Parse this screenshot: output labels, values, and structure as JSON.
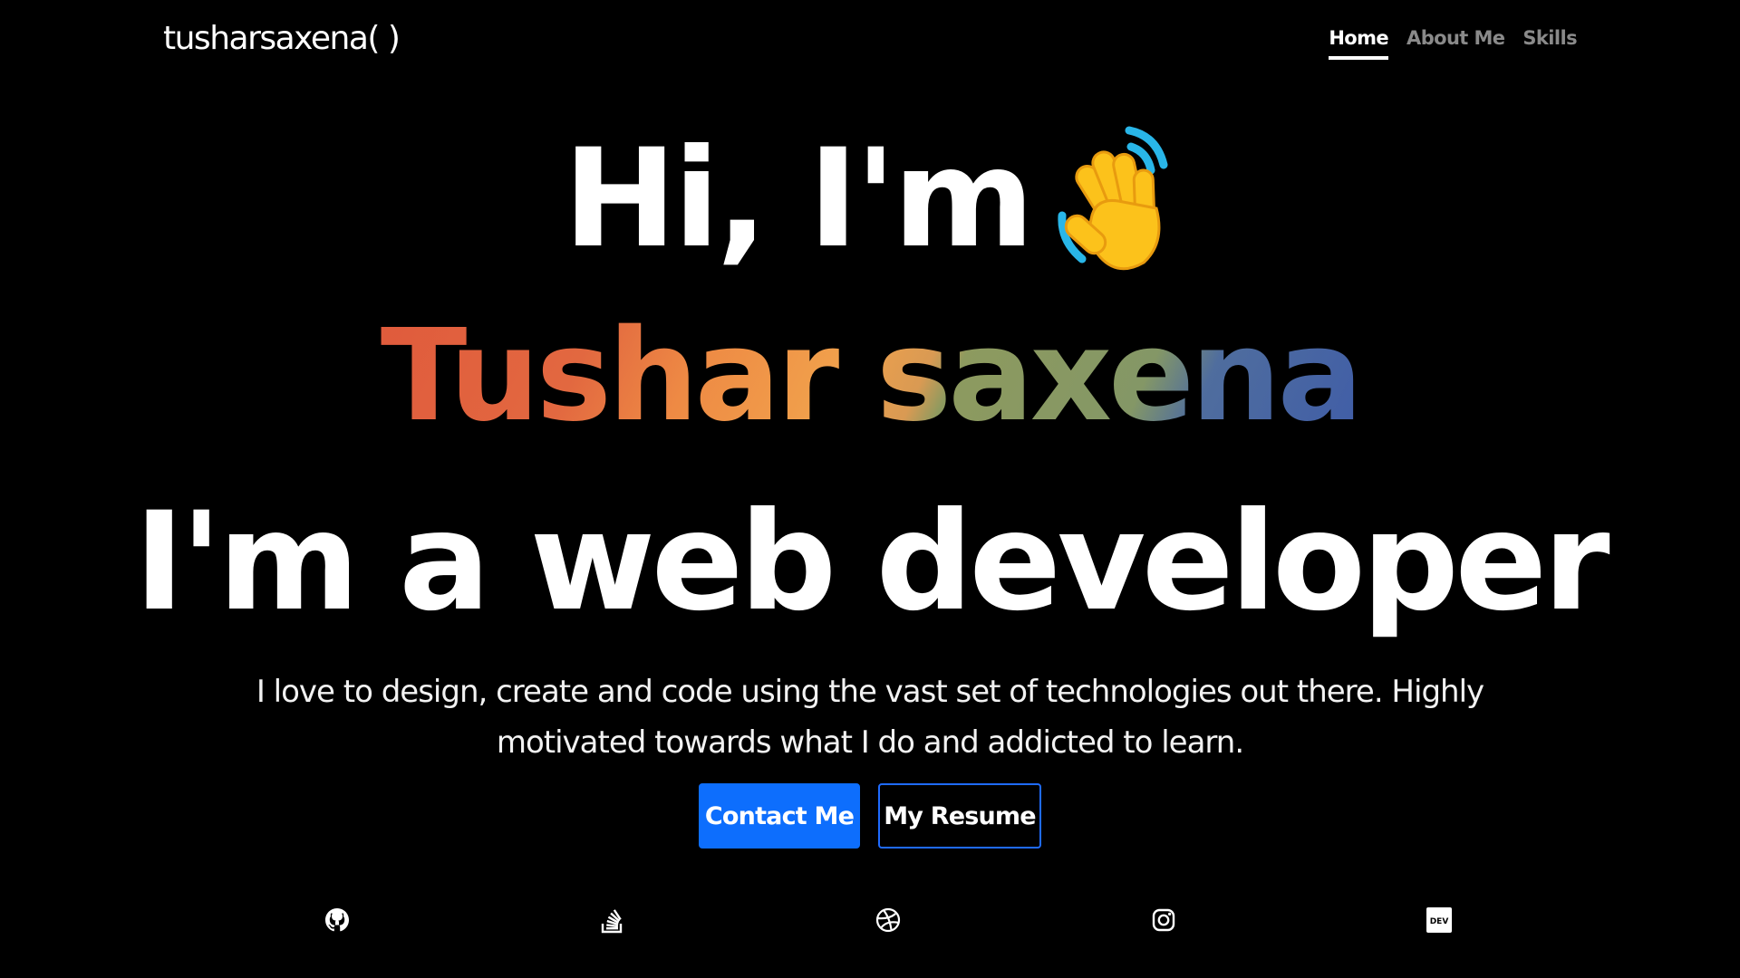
{
  "header": {
    "brand": "tusharsaxena( )",
    "nav": [
      {
        "label": "Home",
        "active": true
      },
      {
        "label": "About Me",
        "active": false
      },
      {
        "label": "Skills",
        "active": false
      }
    ]
  },
  "hero": {
    "greeting": "Hi, I'm",
    "greeting_icon": "waving-hand-icon",
    "name": "Tushar saxena",
    "role": "I'm a web developer",
    "intro": "I love to design, create and code using the vast set of technologies out there. Highly motivated towards what I do and addicted to learn."
  },
  "buttons": {
    "contact": "Contact Me",
    "resume": "My Resume"
  },
  "social": [
    {
      "icon": "github-icon"
    },
    {
      "icon": "stackoverflow-icon"
    },
    {
      "icon": "dribbble-icon"
    },
    {
      "icon": "instagram-icon"
    },
    {
      "icon": "dev-to-icon"
    }
  ],
  "colors": {
    "background": "#000000",
    "primary_button": "#0d6efd",
    "outline_button_border": "#1f6bff",
    "nav_inactive": "#8a8a8a",
    "name_gradient": [
      "#e05a3c",
      "#f1a14c",
      "#849766",
      "#3f5ca8"
    ]
  }
}
